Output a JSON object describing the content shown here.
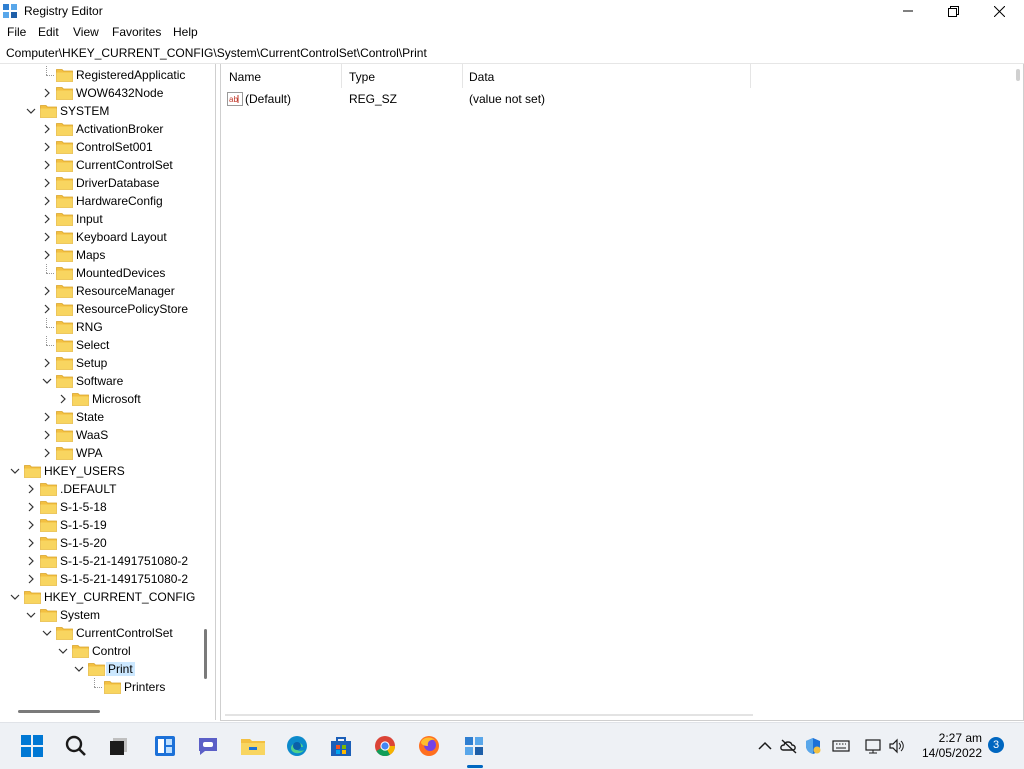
{
  "window": {
    "title": "Registry Editor",
    "controls": [
      "minimize",
      "maximize",
      "close"
    ]
  },
  "menu": [
    "File",
    "Edit",
    "View",
    "Favorites",
    "Help"
  ],
  "address": "Computer\\HKEY_CURRENT_CONFIG\\System\\CurrentControlSet\\Control\\Print",
  "tree": [
    {
      "label": "RegisteredApplicatic",
      "expander": "none",
      "level": 3
    },
    {
      "label": "WOW6432Node",
      "expander": "collapsed",
      "level": 3
    },
    {
      "label": "SYSTEM",
      "expander": "expanded",
      "level": 2
    },
    {
      "label": "ActivationBroker",
      "expander": "collapsed",
      "level": 3
    },
    {
      "label": "ControlSet001",
      "expander": "collapsed",
      "level": 3
    },
    {
      "label": "CurrentControlSet",
      "expander": "collapsed",
      "level": 3
    },
    {
      "label": "DriverDatabase",
      "expander": "collapsed",
      "level": 3
    },
    {
      "label": "HardwareConfig",
      "expander": "collapsed",
      "level": 3
    },
    {
      "label": "Input",
      "expander": "collapsed",
      "level": 3
    },
    {
      "label": "Keyboard Layout",
      "expander": "collapsed",
      "level": 3
    },
    {
      "label": "Maps",
      "expander": "collapsed",
      "level": 3
    },
    {
      "label": "MountedDevices",
      "expander": "none",
      "level": 3
    },
    {
      "label": "ResourceManager",
      "expander": "collapsed",
      "level": 3
    },
    {
      "label": "ResourcePolicyStore",
      "expander": "collapsed",
      "level": 3
    },
    {
      "label": "RNG",
      "expander": "none",
      "level": 3
    },
    {
      "label": "Select",
      "expander": "none",
      "level": 3
    },
    {
      "label": "Setup",
      "expander": "collapsed",
      "level": 3
    },
    {
      "label": "Software",
      "expander": "expanded",
      "level": 3
    },
    {
      "label": "Microsoft",
      "expander": "collapsed",
      "level": 4
    },
    {
      "label": "State",
      "expander": "collapsed",
      "level": 3
    },
    {
      "label": "WaaS",
      "expander": "collapsed",
      "level": 3
    },
    {
      "label": "WPA",
      "expander": "collapsed",
      "level": 3
    },
    {
      "label": "HKEY_USERS",
      "expander": "expanded",
      "level": 1
    },
    {
      "label": ".DEFAULT",
      "expander": "collapsed",
      "level": 2
    },
    {
      "label": "S-1-5-18",
      "expander": "collapsed",
      "level": 2
    },
    {
      "label": "S-1-5-19",
      "expander": "collapsed",
      "level": 2
    },
    {
      "label": "S-1-5-20",
      "expander": "collapsed",
      "level": 2
    },
    {
      "label": "S-1-5-21-1491751080-2",
      "expander": "collapsed",
      "level": 2
    },
    {
      "label": "S-1-5-21-1491751080-2",
      "expander": "collapsed",
      "level": 2
    },
    {
      "label": "HKEY_CURRENT_CONFIG",
      "expander": "expanded",
      "level": 1
    },
    {
      "label": "System",
      "expander": "expanded",
      "level": 2
    },
    {
      "label": "CurrentControlSet",
      "expander": "expanded",
      "level": 3
    },
    {
      "label": "Control",
      "expander": "expanded",
      "level": 4
    },
    {
      "label": "Print",
      "expander": "expanded",
      "level": 5,
      "selected": true
    },
    {
      "label": "Printers",
      "expander": "none",
      "level": 6
    }
  ],
  "list": {
    "columns": [
      "Name",
      "Type",
      "Data"
    ],
    "rows": [
      {
        "name": "(Default)",
        "type": "REG_SZ",
        "data": "(value not set)",
        "icon": "string-value-icon"
      }
    ]
  },
  "taskbar": {
    "apps": [
      "start-icon",
      "search-icon",
      "task-view-icon",
      "widgets-icon",
      "teams-chat-icon",
      "file-explorer-icon",
      "edge-icon",
      "store-icon",
      "chrome-icon",
      "firefox-icon",
      "registry-editor-icon"
    ],
    "active_app": "registry-editor-icon",
    "tray": [
      "chevron-up-icon",
      "onedrive-icon",
      "defender-icon",
      "keyboard-icon",
      "network-icon",
      "volume-icon"
    ],
    "time": "2:27 am",
    "date": "14/05/2022",
    "notifications": "3"
  },
  "colors": {
    "selection": "#cce8ff",
    "folder": "#f3c041",
    "accent": "#0067c0"
  }
}
